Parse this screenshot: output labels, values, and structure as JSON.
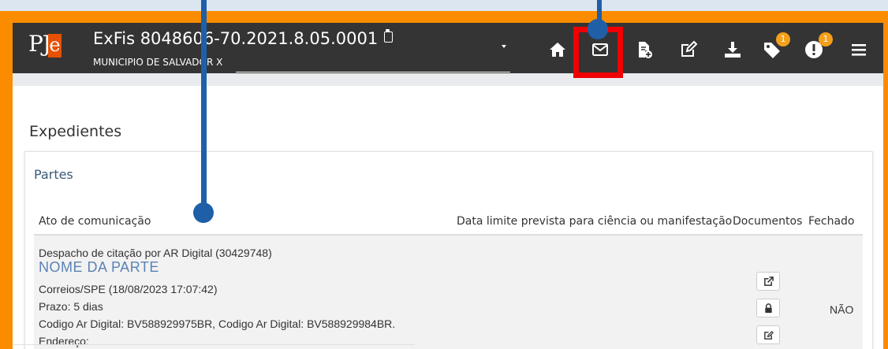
{
  "header": {
    "logo_text": "PJe",
    "process_title": "ExFis 8048606-70.2021.8.05.0001",
    "party_subtitle": "MUNICIPIO DE SALVADOR X",
    "badges": {
      "tags_count": "1",
      "alerts_count": "1"
    },
    "icons": [
      "home-icon",
      "envelope-icon",
      "file-plus-icon",
      "edit-icon",
      "download-icon",
      "tag-icon",
      "alert-icon",
      "menu-icon"
    ]
  },
  "page": {
    "title": "Expedientes",
    "section_title": "Partes"
  },
  "table": {
    "columns": [
      "Ato de comunicação",
      "Data limite prevista para ciência ou manifestação",
      "Documentos",
      "Fechado"
    ],
    "rows": [
      {
        "ato": "Despacho de citação por AR Digital (30429748)",
        "parte": "NOME DA PARTE",
        "correios": "Correios/SPE (18/08/2023 17:07:42)",
        "prazo": "Prazo: 5 dias",
        "codigo": "Codigo Ar Digital: BV588929975BR, Codigo Ar Digital: BV588929984BR.",
        "endereco": "Endereço:",
        "fechado": "NÃO"
      }
    ]
  },
  "colors": {
    "frame": "#fb8c00",
    "topbar": "#343434",
    "highlight": "#f00000",
    "pin": "#1f5fa8",
    "badge": "#f4a019",
    "name_link": "#5a83b5"
  }
}
